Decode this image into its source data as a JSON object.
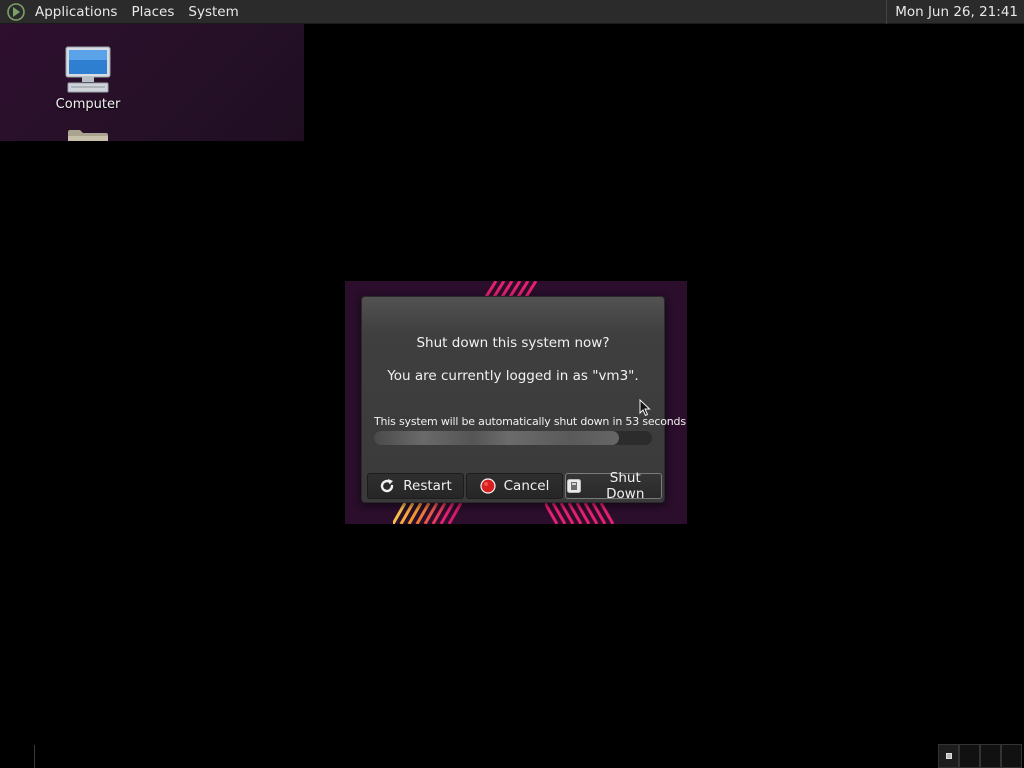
{
  "top_panel": {
    "menus": [
      "Applications",
      "Places",
      "System"
    ],
    "clock": "Mon Jun 26, 21:41"
  },
  "desktop": {
    "icons": [
      {
        "label": "Computer",
        "icon": "computer-icon"
      },
      {
        "label": "",
        "icon": "folder-icon"
      }
    ]
  },
  "dialog": {
    "title": "Shut down this system now?",
    "subtitle": "You are currently logged in as \"vm3\".",
    "countdown_text": "This system will be automatically shut down in 53 seconds",
    "progress_percent": 88,
    "buttons": {
      "restart": "Restart",
      "cancel": "Cancel",
      "shutdown": "Shut Down"
    }
  },
  "bottom_panel": {
    "workspaces": 4,
    "active_workspace": 1
  },
  "colors": {
    "panel_bg": "#2b2b2b",
    "dialog_bg": "#3a3a3a",
    "accent_pink": "#e5206e",
    "accent_orange": "#f29a2e",
    "cancel_red": "#d91e1e"
  }
}
